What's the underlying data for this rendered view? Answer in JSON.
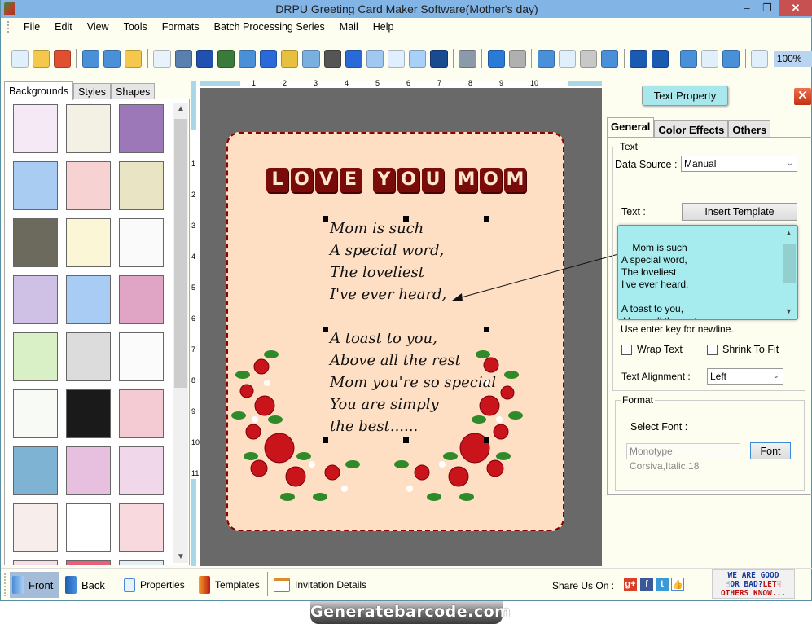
{
  "window": {
    "title": "DRPU Greeting Card Maker Software(Mother's day)",
    "controls": {
      "minimize": "–",
      "maximize": "❐",
      "close": "✕"
    }
  },
  "menu": [
    "File",
    "Edit",
    "View",
    "Tools",
    "Formats",
    "Batch Processing Series",
    "Mail",
    "Help"
  ],
  "toolbar": {
    "icons": [
      "new-icon",
      "open-icon",
      "close-icon",
      "save-icon",
      "save-as-icon",
      "export-icon",
      "properties-icon",
      "print-icon",
      "background-icon",
      "card-icon",
      "image-icon",
      "pen-icon",
      "shapes-icon",
      "wordart-icon",
      "barcode-icon",
      "text-icon",
      "text-box-icon",
      "signature-icon",
      "mail-icon",
      "line-icon",
      "database-icon",
      "undo-icon",
      "redo-icon",
      "cut-icon",
      "copy-icon",
      "paste-icon",
      "delete-icon",
      "bring-front-icon",
      "send-back-icon",
      "grid-icon",
      "actual-size-icon",
      "fit-window-icon",
      "zoom-icon"
    ],
    "zoom_value": "100%"
  },
  "left_panel": {
    "tabs": [
      "Backgrounds",
      "Styles",
      "Shapes"
    ],
    "active_tab": "Backgrounds",
    "thumbnails": [
      "baby-pink",
      "baby-cream",
      "purple-floral",
      "sky-clouds",
      "strawberries",
      "autumn-leaves",
      "dark-leaves",
      "flower-rows",
      "gift-boxes",
      "pastel-circles",
      "snowflakes",
      "mandalas",
      "green-trees",
      "white-heart",
      "kids-doodles",
      "green-hearts",
      "fireworks",
      "red-hearts",
      "santa-pattern",
      "pink-bubbles",
      "pink-lilies",
      "pastel-stripes",
      "teddy-bear",
      "pink-dress"
    ],
    "thumbnail_colors": [
      "#f4e9f4",
      "#f3f1e3",
      "#9c78b8",
      "#a9cdf2",
      "#f6d2d2",
      "#e9e4c4",
      "#6c6a5c",
      "#fbf7d6",
      "#fafafa",
      "#cfc0e6",
      "#a9ccf5",
      "#e0a4c4",
      "#d9f0c6",
      "#dcdcdc",
      "#fbfbfb",
      "#f8fbf5",
      "#1a1a1a",
      "#f4cbd2",
      "#7fb3d4",
      "#e7c0e0",
      "#f1d7ea",
      "#f7edeb",
      "#ffffff",
      "#f8d9de"
    ]
  },
  "ruler": {
    "top_ticks": [
      "1",
      "2",
      "3",
      "4",
      "5",
      "6",
      "7",
      "8",
      "9",
      "10"
    ],
    "left_ticks": [
      "1",
      "2",
      "3",
      "4",
      "5",
      "6",
      "7",
      "8",
      "9",
      "10",
      "11"
    ]
  },
  "card": {
    "headline_words": [
      "LOVE",
      "YOU",
      "MOM"
    ],
    "poem": "Mom is such\nA special word,\nThe loveliest\nI've ever heard,\n\nA toast to you,\nAbove all the rest\nMom you're so special\nYou are simply\nthe best......",
    "colors": {
      "card_bg": "#ffdfc4",
      "border": "#8b0000",
      "headline": "#7a0b0b"
    }
  },
  "text_property": {
    "title": "Text Property",
    "close": "✕",
    "tabs": [
      "General",
      "Color Effects",
      "Others"
    ],
    "active_tab": "General",
    "text_group": "Text",
    "data_source_label": "Data Source :",
    "data_source_value": "Manual",
    "text_label": "Text :",
    "insert_template": "Insert Template",
    "text_value": "Mom is such\nA special word,\nThe loveliest\nI've ever heard,\n\nA toast to you,\nAbove all the rest",
    "hint": "Use enter key for newline.",
    "wrap_text": "Wrap Text",
    "wrap_text_checked": false,
    "shrink_to_fit": "Shrink To Fit",
    "shrink_to_fit_checked": false,
    "alignment_label": "Text Alignment :",
    "alignment_value": "Left",
    "format_group": "Format",
    "select_font_label": "Select Font :",
    "font_value": "Monotype Corsiva,Italic,18",
    "font_button": "Font"
  },
  "bottom_bar": {
    "items": [
      "Front",
      "Back",
      "Properties",
      "Templates",
      "Invitation Details"
    ],
    "active": "Front",
    "share_label": "Share Us On :",
    "social": [
      "google-plus",
      "facebook",
      "twitter",
      "like"
    ],
    "feedback": {
      "line1": "WE ARE GOOD",
      "line2a": "OR BAD?",
      "line2b": "LET",
      "line3": "OTHERS KNOW..."
    }
  },
  "watermark": "Generatebarcode.com"
}
